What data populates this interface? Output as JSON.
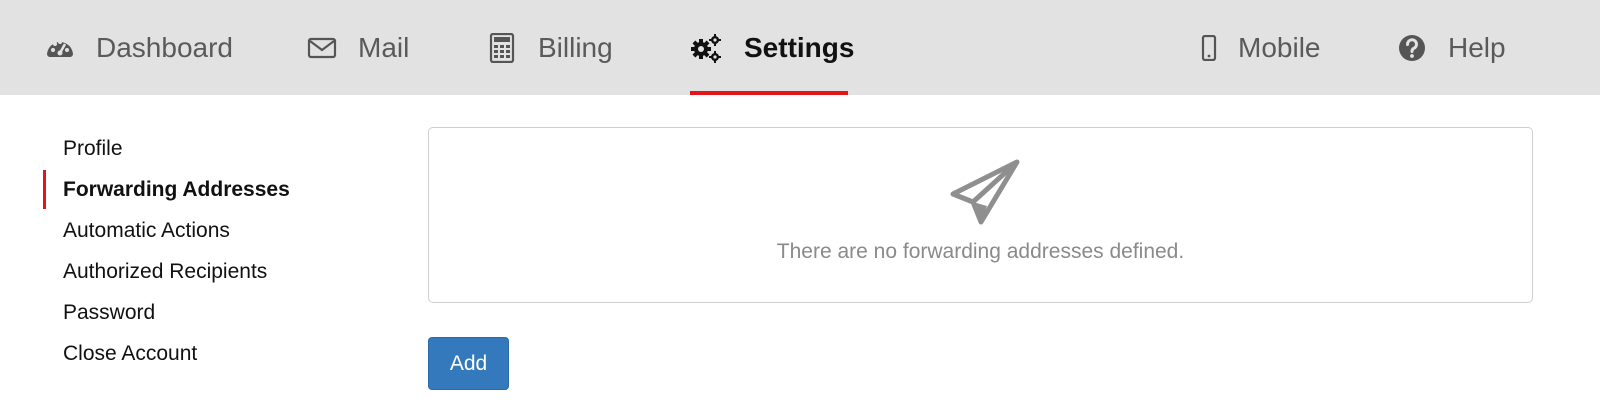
{
  "nav": {
    "dashboard": {
      "label": "Dashboard",
      "icon": "tachometer-icon"
    },
    "mail": {
      "label": "Mail",
      "icon": "envelope-icon"
    },
    "billing": {
      "label": "Billing",
      "icon": "calculator-icon"
    },
    "settings": {
      "label": "Settings",
      "icon": "gears-icon"
    },
    "mobile": {
      "label": "Mobile",
      "icon": "mobile-phone-icon"
    },
    "help": {
      "label": "Help",
      "icon": "question-circle-icon"
    },
    "active": "Settings",
    "active_color": "#e4141b"
  },
  "sidebar": {
    "items": [
      {
        "label": "Profile"
      },
      {
        "label": "Forwarding Addresses"
      },
      {
        "label": "Automatic Actions"
      },
      {
        "label": "Authorized Recipients"
      },
      {
        "label": "Password"
      },
      {
        "label": "Close Account"
      }
    ],
    "active": "Forwarding Addresses"
  },
  "main": {
    "empty_icon": "paper-plane-icon",
    "empty_message": "There are no forwarding addresses defined.",
    "add_label": "Add"
  },
  "colors": {
    "topbar_bg": "#e2e2e2",
    "accent": "#e4141b",
    "primary_button": "#3379bb"
  }
}
